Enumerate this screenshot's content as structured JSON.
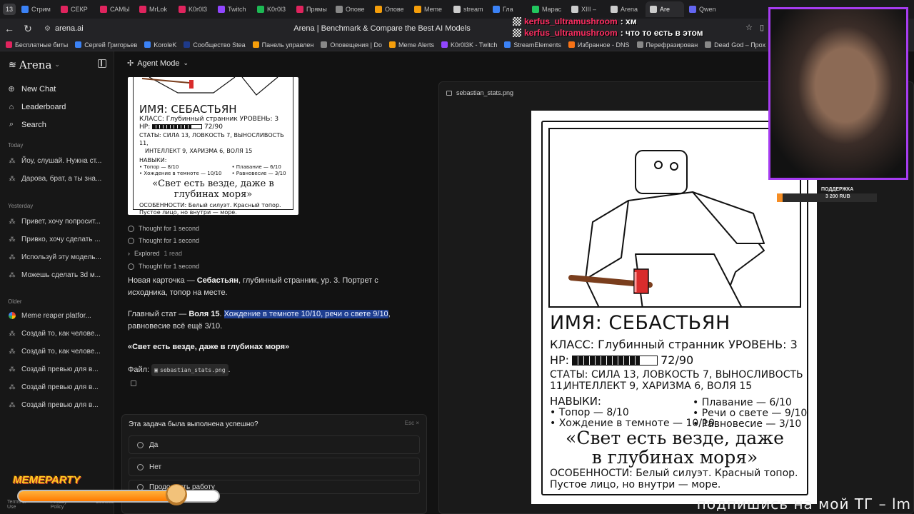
{
  "browser": {
    "tab_count": "13",
    "tabs": [
      {
        "label": "Стрим",
        "color": "#3b82f6",
        "active": false
      },
      {
        "label": "СЕКР",
        "color": "#e0245e",
        "active": false
      },
      {
        "label": "САМЫ",
        "color": "#e0245e",
        "active": false
      },
      {
        "label": "MrLok",
        "color": "#e0245e",
        "active": false
      },
      {
        "label": "K0r0l3",
        "color": "#e0245e",
        "active": false
      },
      {
        "label": "Twitch",
        "color": "#9146ff",
        "active": false
      },
      {
        "label": "K0r0l3",
        "color": "#1db954",
        "active": false
      },
      {
        "label": "Прямы",
        "color": "#e0245e",
        "active": false
      },
      {
        "label": "Опове",
        "color": "#888888",
        "active": false
      },
      {
        "label": "Опове",
        "color": "#f59e0b",
        "active": false
      },
      {
        "label": "Meme",
        "color": "#f59e0b",
        "active": false
      },
      {
        "label": "stream",
        "color": "#cccccc",
        "active": false
      },
      {
        "label": "Гла",
        "color": "#3b82f6",
        "active": false
      },
      {
        "label": "Марас",
        "color": "#22c55e",
        "active": false
      },
      {
        "label": "XIII –",
        "color": "#cccccc",
        "active": false
      },
      {
        "label": "Arena",
        "color": "#cccccc",
        "active": false
      },
      {
        "label": "Are",
        "color": "#cccccc",
        "active": true
      },
      {
        "label": "Qwen",
        "color": "#6366f1",
        "active": false
      }
    ],
    "url": "arena.ai",
    "page_title": "Arena | Benchmark & Compare the Best AI Models",
    "ask_label": "Спросить",
    "bookmarks": [
      {
        "label": "Бесплатные биты",
        "color": "#e0245e"
      },
      {
        "label": "Сергей Григорьев",
        "color": "#3b82f6"
      },
      {
        "label": "KoroleK",
        "color": "#3b82f6"
      },
      {
        "label": "Сообщество Stea",
        "color": "#1e3a8a"
      },
      {
        "label": "Панель управлен",
        "color": "#f59e0b"
      },
      {
        "label": "Оповещения | Do",
        "color": "#888888"
      },
      {
        "label": "Meme Alerts",
        "color": "#f59e0b"
      },
      {
        "label": "K0r0l3K - Twitch",
        "color": "#9146ff"
      },
      {
        "label": "StreamElements",
        "color": "#3b82f6"
      },
      {
        "label": "Избранное - DNS",
        "color": "#f97316"
      },
      {
        "label": "Перефразирован",
        "color": "#888888"
      },
      {
        "label": "Dead God – Прох",
        "color": "#888888"
      }
    ]
  },
  "sidebar": {
    "brand": "Arena",
    "nav": [
      {
        "icon": "plus-circle-icon",
        "glyph": "⊕",
        "label": "New Chat"
      },
      {
        "icon": "trophy-icon",
        "glyph": "⌂",
        "label": "Leaderboard"
      },
      {
        "icon": "search-icon",
        "glyph": "⌕",
        "label": "Search"
      }
    ],
    "today_label": "Today",
    "today": [
      "Йоу, слушай. Нужна ст...",
      "Дарова, брат, а ты зна..."
    ],
    "yesterday_label": "Yesterday",
    "yesterday": [
      "Привет, хочу попросит...",
      "Привко, хочу сделать ...",
      "Используй эту модель...",
      "Можешь сделать 3d м..."
    ],
    "older_label": "Older",
    "older": [
      "Meme reaper platfor...",
      "Создай то, как челове...",
      "Создай то, как челове...",
      "Создай превью для в...",
      "Создай превью для в...",
      "Создай превью для в..."
    ],
    "footer": [
      "Terms of Use",
      "Privacy Policy",
      "Cookies"
    ]
  },
  "main": {
    "agent_mode": "Agent Mode",
    "thumb": {
      "name": "ИМЯ: СЕБАСТЬЯН",
      "class_line": "КЛАСС: Глубинный странник   УРОВЕНЬ: 3",
      "hp_label": "HP:",
      "hp_value": "72/90",
      "stats_1": "СТАТЫ: СИЛА 13, ЛОВКОСТЬ 7, ВЫНОСЛИВОСТЬ 11,",
      "stats_2": "ИНТЕЛЛЕКТ 9, ХАРИЗМА 6, ВОЛЯ 15",
      "skills_label": "НАВЫКИ:",
      "quote": "«Свет есть везде, даже в глубинах моря»",
      "features_1": "ОСОБЕННОСТИ: Белый силуэт. Красный топор.",
      "features_2": "Пустое лицо, но внутри — море."
    },
    "thoughts": [
      "Thought for 1 second",
      "Thought for 1 second",
      "Explored",
      "Thought for 1 second"
    ],
    "explored_extra": "1 read",
    "msg1_pre": "Новая карточка — ",
    "msg1_bold": "Себастьян",
    "msg1_post": ", глубинный странник, ур. 3. Портрет с исходника, топор на месте.",
    "msg2_pre": "Главный стат — ",
    "msg2_bold": "Воля 15",
    "msg2_sep": ". ",
    "msg2_highlight": "Хождение в темноте 10/10, речи о свете 9/10",
    "msg2_post": ", равновесие всё ещё 3/10.",
    "msg3_bold": "«Свет есть везде, даже в глубинах моря»",
    "file_label": "Файл:",
    "file_name": "sebastian_stats.png",
    "feedback": {
      "question": "Эта задача была выполнена успешно?",
      "dismiss": "Esc ×",
      "options": [
        "Да",
        "Нет",
        "Продолжить работу"
      ]
    }
  },
  "preview": {
    "filename": "sebastian_stats.png",
    "card": {
      "name": "ИМЯ: СЕБАСТЬЯН",
      "class_line": "КЛАСС: Глубинный странник   УРОВЕНЬ: 3",
      "hp_label": "HP:",
      "hp_value": "72/90",
      "hp_fraction": 0.8,
      "stats_label": "СТАТЫ:",
      "stats_1": "СИЛА 13, ЛОВКОСТЬ 7, ВЫНОСЛИВОСТЬ 11,",
      "stats_2": "ИНТЕЛЛЕКТ 9, ХАРИЗМА 6, ВОЛЯ 15",
      "skills_label": "НАВЫКИ:",
      "skills_left": [
        "• Топор — 8/10",
        "• Хождение в темноте — 10/10"
      ],
      "skills_right": [
        "• Плавание — 6/10",
        "• Речи о свете — 9/10",
        "• Равновесие — 3/10"
      ],
      "quote_1": "«Свет есть везде, даже",
      "quote_2": "в глубинах моря»",
      "features_1": "ОСОБЕННОСТИ: Белый силуэт. Красный топор.",
      "features_2": "Пустое лицо, но внутри — море."
    }
  },
  "stream": {
    "chat": [
      {
        "user": "kerfus_ultramushroom",
        "text": ": хм"
      },
      {
        "user": "kerfus_ultramushroom",
        "text": ": что то есть в этом"
      }
    ],
    "donate_title": "ПОДДЕРЖКА",
    "donate_amount": "3 200 RUB",
    "donate_progress": 0.06,
    "memeparty": "MEMEPARTY",
    "memeparty_progress": 0.78,
    "ticker": "подпишись на мой ТГ – lm"
  }
}
